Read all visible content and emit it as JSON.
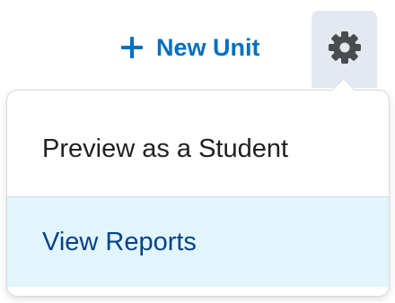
{
  "toolbar": {
    "new_unit_label": "New Unit",
    "new_unit_icon": "plus-icon",
    "settings_icon": "gear-icon"
  },
  "menu": {
    "items": [
      {
        "label": "Preview as a Student",
        "state": "default"
      },
      {
        "label": "View Reports",
        "state": "hovered"
      }
    ]
  },
  "colors": {
    "accent": "#006fbf",
    "text": "#202122",
    "hover_text": "#004489",
    "hover_bg": "#e3f5fc",
    "settings_bg": "#e3e9f1",
    "border": "#d3d9e3"
  }
}
